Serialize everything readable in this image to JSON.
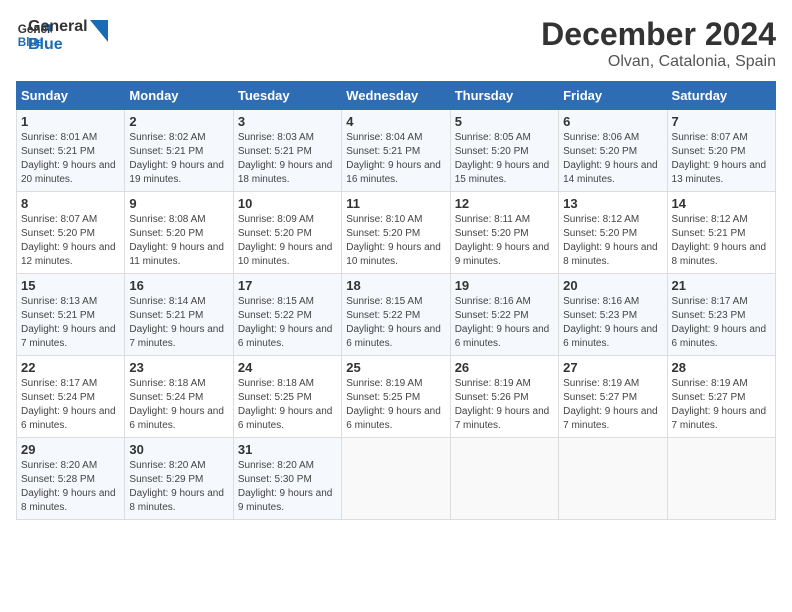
{
  "logo": {
    "line1": "General",
    "line2": "Blue"
  },
  "title": "December 2024",
  "subtitle": "Olvan, Catalonia, Spain",
  "days_header": [
    "Sunday",
    "Monday",
    "Tuesday",
    "Wednesday",
    "Thursday",
    "Friday",
    "Saturday"
  ],
  "weeks": [
    [
      {
        "day": "1",
        "sunrise": "Sunrise: 8:01 AM",
        "sunset": "Sunset: 5:21 PM",
        "daylight": "Daylight: 9 hours and 20 minutes."
      },
      {
        "day": "2",
        "sunrise": "Sunrise: 8:02 AM",
        "sunset": "Sunset: 5:21 PM",
        "daylight": "Daylight: 9 hours and 19 minutes."
      },
      {
        "day": "3",
        "sunrise": "Sunrise: 8:03 AM",
        "sunset": "Sunset: 5:21 PM",
        "daylight": "Daylight: 9 hours and 18 minutes."
      },
      {
        "day": "4",
        "sunrise": "Sunrise: 8:04 AM",
        "sunset": "Sunset: 5:21 PM",
        "daylight": "Daylight: 9 hours and 16 minutes."
      },
      {
        "day": "5",
        "sunrise": "Sunrise: 8:05 AM",
        "sunset": "Sunset: 5:20 PM",
        "daylight": "Daylight: 9 hours and 15 minutes."
      },
      {
        "day": "6",
        "sunrise": "Sunrise: 8:06 AM",
        "sunset": "Sunset: 5:20 PM",
        "daylight": "Daylight: 9 hours and 14 minutes."
      },
      {
        "day": "7",
        "sunrise": "Sunrise: 8:07 AM",
        "sunset": "Sunset: 5:20 PM",
        "daylight": "Daylight: 9 hours and 13 minutes."
      }
    ],
    [
      {
        "day": "8",
        "sunrise": "Sunrise: 8:07 AM",
        "sunset": "Sunset: 5:20 PM",
        "daylight": "Daylight: 9 hours and 12 minutes."
      },
      {
        "day": "9",
        "sunrise": "Sunrise: 8:08 AM",
        "sunset": "Sunset: 5:20 PM",
        "daylight": "Daylight: 9 hours and 11 minutes."
      },
      {
        "day": "10",
        "sunrise": "Sunrise: 8:09 AM",
        "sunset": "Sunset: 5:20 PM",
        "daylight": "Daylight: 9 hours and 10 minutes."
      },
      {
        "day": "11",
        "sunrise": "Sunrise: 8:10 AM",
        "sunset": "Sunset: 5:20 PM",
        "daylight": "Daylight: 9 hours and 10 minutes."
      },
      {
        "day": "12",
        "sunrise": "Sunrise: 8:11 AM",
        "sunset": "Sunset: 5:20 PM",
        "daylight": "Daylight: 9 hours and 9 minutes."
      },
      {
        "day": "13",
        "sunrise": "Sunrise: 8:12 AM",
        "sunset": "Sunset: 5:20 PM",
        "daylight": "Daylight: 9 hours and 8 minutes."
      },
      {
        "day": "14",
        "sunrise": "Sunrise: 8:12 AM",
        "sunset": "Sunset: 5:21 PM",
        "daylight": "Daylight: 9 hours and 8 minutes."
      }
    ],
    [
      {
        "day": "15",
        "sunrise": "Sunrise: 8:13 AM",
        "sunset": "Sunset: 5:21 PM",
        "daylight": "Daylight: 9 hours and 7 minutes."
      },
      {
        "day": "16",
        "sunrise": "Sunrise: 8:14 AM",
        "sunset": "Sunset: 5:21 PM",
        "daylight": "Daylight: 9 hours and 7 minutes."
      },
      {
        "day": "17",
        "sunrise": "Sunrise: 8:15 AM",
        "sunset": "Sunset: 5:22 PM",
        "daylight": "Daylight: 9 hours and 6 minutes."
      },
      {
        "day": "18",
        "sunrise": "Sunrise: 8:15 AM",
        "sunset": "Sunset: 5:22 PM",
        "daylight": "Daylight: 9 hours and 6 minutes."
      },
      {
        "day": "19",
        "sunrise": "Sunrise: 8:16 AM",
        "sunset": "Sunset: 5:22 PM",
        "daylight": "Daylight: 9 hours and 6 minutes."
      },
      {
        "day": "20",
        "sunrise": "Sunrise: 8:16 AM",
        "sunset": "Sunset: 5:23 PM",
        "daylight": "Daylight: 9 hours and 6 minutes."
      },
      {
        "day": "21",
        "sunrise": "Sunrise: 8:17 AM",
        "sunset": "Sunset: 5:23 PM",
        "daylight": "Daylight: 9 hours and 6 minutes."
      }
    ],
    [
      {
        "day": "22",
        "sunrise": "Sunrise: 8:17 AM",
        "sunset": "Sunset: 5:24 PM",
        "daylight": "Daylight: 9 hours and 6 minutes."
      },
      {
        "day": "23",
        "sunrise": "Sunrise: 8:18 AM",
        "sunset": "Sunset: 5:24 PM",
        "daylight": "Daylight: 9 hours and 6 minutes."
      },
      {
        "day": "24",
        "sunrise": "Sunrise: 8:18 AM",
        "sunset": "Sunset: 5:25 PM",
        "daylight": "Daylight: 9 hours and 6 minutes."
      },
      {
        "day": "25",
        "sunrise": "Sunrise: 8:19 AM",
        "sunset": "Sunset: 5:25 PM",
        "daylight": "Daylight: 9 hours and 6 minutes."
      },
      {
        "day": "26",
        "sunrise": "Sunrise: 8:19 AM",
        "sunset": "Sunset: 5:26 PM",
        "daylight": "Daylight: 9 hours and 7 minutes."
      },
      {
        "day": "27",
        "sunrise": "Sunrise: 8:19 AM",
        "sunset": "Sunset: 5:27 PM",
        "daylight": "Daylight: 9 hours and 7 minutes."
      },
      {
        "day": "28",
        "sunrise": "Sunrise: 8:19 AM",
        "sunset": "Sunset: 5:27 PM",
        "daylight": "Daylight: 9 hours and 7 minutes."
      }
    ],
    [
      {
        "day": "29",
        "sunrise": "Sunrise: 8:20 AM",
        "sunset": "Sunset: 5:28 PM",
        "daylight": "Daylight: 9 hours and 8 minutes."
      },
      {
        "day": "30",
        "sunrise": "Sunrise: 8:20 AM",
        "sunset": "Sunset: 5:29 PM",
        "daylight": "Daylight: 9 hours and 8 minutes."
      },
      {
        "day": "31",
        "sunrise": "Sunrise: 8:20 AM",
        "sunset": "Sunset: 5:30 PM",
        "daylight": "Daylight: 9 hours and 9 minutes."
      },
      null,
      null,
      null,
      null
    ]
  ]
}
